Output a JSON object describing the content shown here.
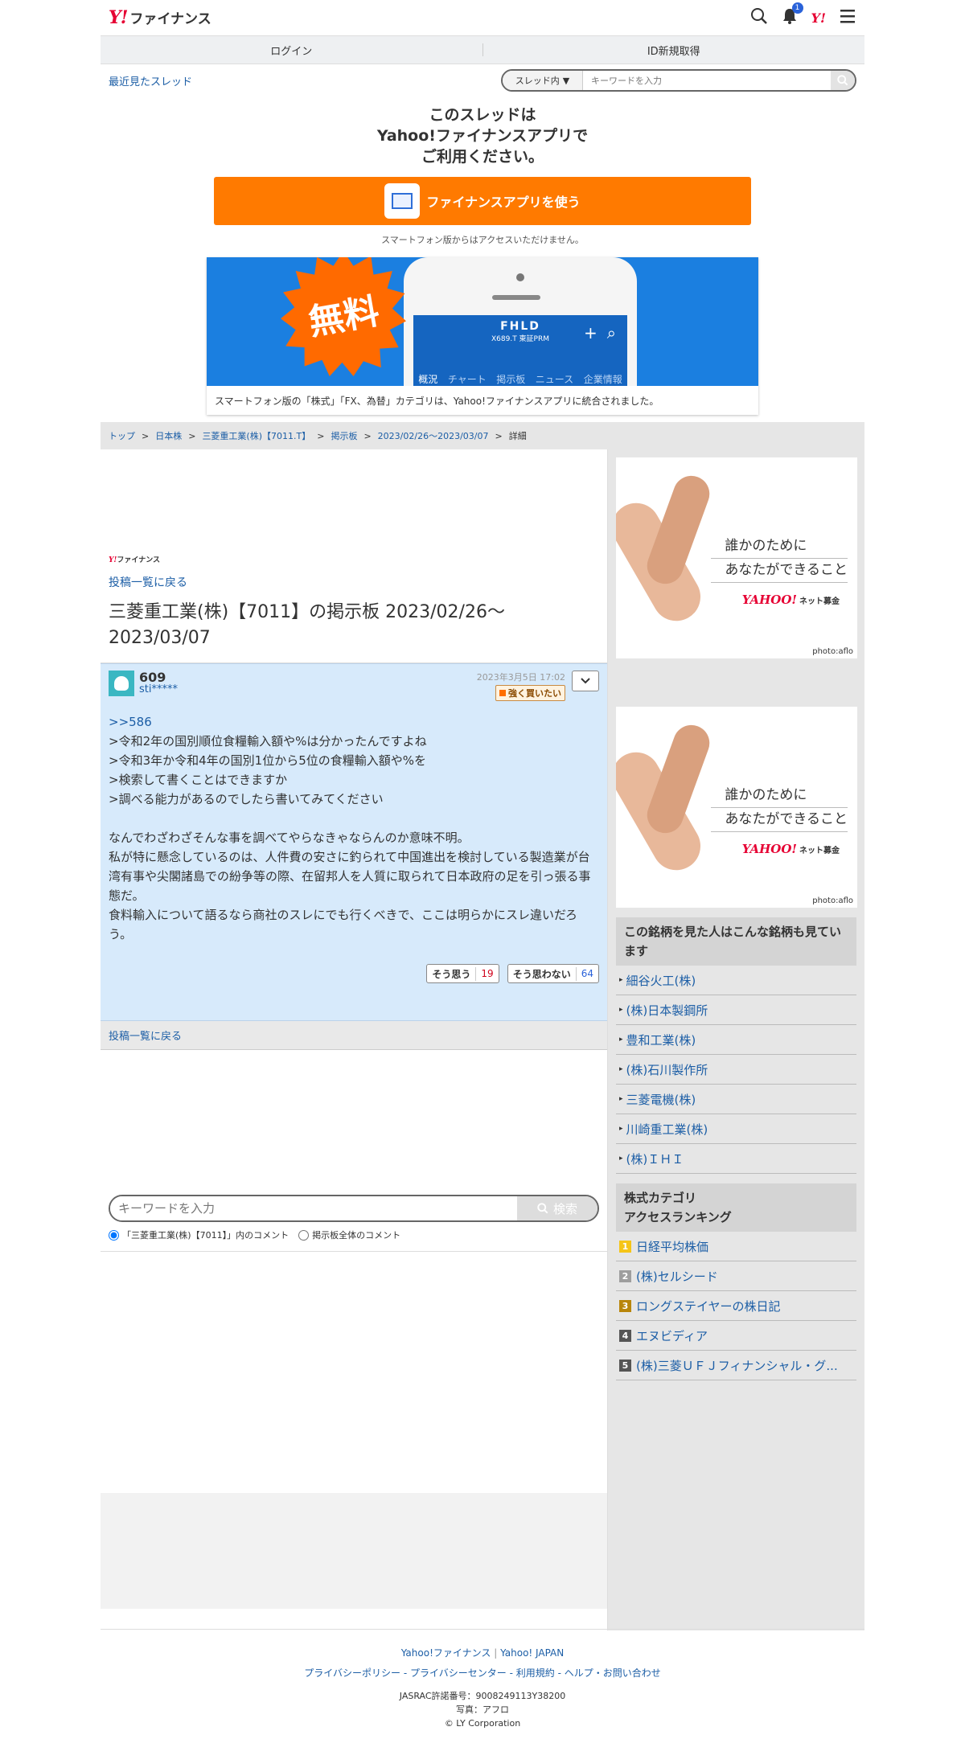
{
  "header": {
    "logo_y": "Y!",
    "logo_text": "ファイナンス",
    "notif_count": "1",
    "yahoo_logo": "Y!"
  },
  "loginbar": {
    "login": "ログイン",
    "register": "ID新規取得"
  },
  "subbar": {
    "recent": "最近見たスレッド",
    "scope": "スレッド内",
    "placeholder": "キーワードを入力"
  },
  "promo": {
    "line1": "このスレッドは",
    "line2": "Yahoo!ファイナンスアプリで",
    "line3": "ご利用ください。",
    "button": "ファイナンスアプリを使う",
    "note": "スマートフォン版からはアクセスいただけません。"
  },
  "banner": {
    "free": "無料",
    "ticker": "FHLD",
    "code": "X689.T 東証PRM",
    "tabs": [
      "概況",
      "チャート",
      "掲示板",
      "ニュース",
      "企業情報"
    ],
    "caption": "スマートフォン版の「株式」「FX、為替」カテゴリは、Yahoo!ファイナンスアプリに統合されました。"
  },
  "breadcrumbs": {
    "top": "トップ",
    "japan": "日本株",
    "company": "三菱重工業(株)【7011.T】",
    "board": "掲示板",
    "range": "2023/02/26〜2023/03/07",
    "detail": "詳細",
    "sep": ">"
  },
  "board": {
    "logo_y": "Y!",
    "logo_text": "ファイナンス",
    "back": "投稿一覧に戻る",
    "title": "三菱重工業(株)【7011】の掲示板 2023/02/26〜2023/03/07"
  },
  "post": {
    "number": "609",
    "user": "sti*****",
    "date": "2023年3月5日 17:02",
    "sentiment": "強く買いたい",
    "quote": ">>586",
    "lines": [
      ">令和2年の国別順位食糧輸入額や%は分かったんですよね",
      ">令和3年か令和4年の国別1位から5位の食糧輸入額や%を",
      ">検索して書くことはできますか",
      ">調べる能力があるのでしたら書いてみてください",
      "",
      "なんでわざわざそんな事を調べてやらなきゃならんのか意味不明。",
      "私が特に懸念しているのは、人件費の安さに釣られて中国進出を検討している製造業が台湾有事や尖閣諸島での紛争等の際、在留邦人を人質に取られて日本政府の足を引っ張る事態だ。",
      "食料輸入について語るなら商社のスレにでも行くべきで、ここは明らかにスレ違いだろう。"
    ],
    "agree_label": "そう思う",
    "agree_count": "19",
    "disagree_label": "そう思わない",
    "disagree_count": "64"
  },
  "bottom": {
    "back": "投稿一覧に戻る",
    "placeholder": "キーワードを入力",
    "search_button": "検索",
    "radio1": "「三菱重工業(株)【7011】」内のコメント",
    "radio2": "掲示板全体のコメント"
  },
  "ad": {
    "line1": "誰かのために",
    "line2": "あなたができること",
    "brand": "YAHOO!",
    "brand_sub": "ネット募金",
    "photo": "photo:aflo"
  },
  "related": {
    "title": "この銘柄を見た人はこんな銘柄も見ています",
    "items": [
      "細谷火工(株)",
      "(株)日本製鋼所",
      "豊和工業(株)",
      "(株)石川製作所",
      "三菱電機(株)",
      "川崎重工業(株)",
      "(株)ＩＨＩ"
    ]
  },
  "ranking": {
    "title1": "株式カテゴリ",
    "title2": "アクセスランキング",
    "items": [
      {
        "rank": "1",
        "label": "日経平均株価",
        "color": "#f5c518"
      },
      {
        "rank": "2",
        "label": "(株)セルシード",
        "color": "#9e9e9e"
      },
      {
        "rank": "3",
        "label": "ロングステイヤーの株日記",
        "color": "#b8860b"
      },
      {
        "rank": "4",
        "label": "エヌビディア",
        "color": "#555555"
      },
      {
        "rank": "5",
        "label": "(株)三菱ＵＦＪフィナンシャル・グ...",
        "color": "#555555"
      }
    ]
  },
  "footer": {
    "link1": "Yahoo!ファイナンス",
    "link2": "Yahoo! JAPAN",
    "policy": "プライバシーポリシー",
    "privacy_center": "プライバシーセンター",
    "terms": "利用規約",
    "help": "ヘルプ・お問い合わせ",
    "jasrac": "JASRAC許諾番号：9008249113Y38200",
    "photo": "写真：アフロ",
    "copyright": "© LY Corporation"
  }
}
